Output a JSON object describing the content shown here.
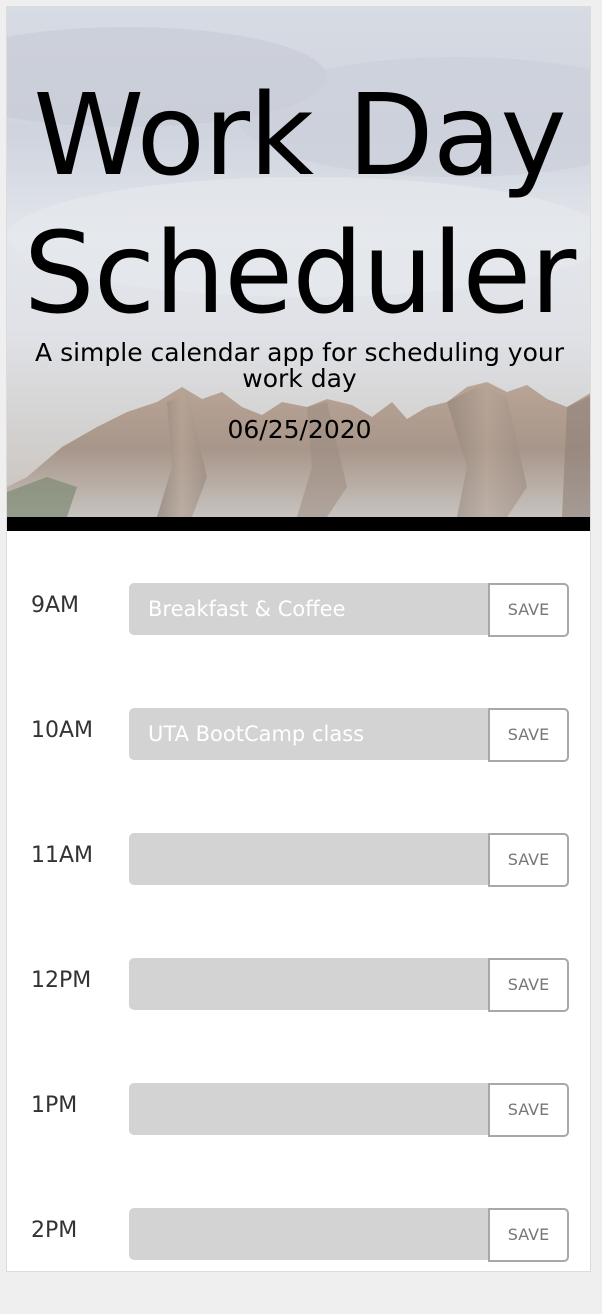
{
  "header": {
    "title": "Work Day Scheduler",
    "subtitle": "A simple calendar app for scheduling your work day",
    "date": "06/25/2020"
  },
  "schedule": {
    "save_label": "SAVE",
    "rows": [
      {
        "hour": "9AM",
        "text": "Breakfast & Coffee"
      },
      {
        "hour": "10AM",
        "text": "UTA BootCamp class"
      },
      {
        "hour": "11AM",
        "text": ""
      },
      {
        "hour": "12PM",
        "text": ""
      },
      {
        "hour": "1PM",
        "text": ""
      },
      {
        "hour": "2PM",
        "text": ""
      }
    ]
  },
  "colors": {
    "header_bar": "#000000",
    "time_block": "#d3d3d3",
    "save_border": "#a8a8a8"
  }
}
